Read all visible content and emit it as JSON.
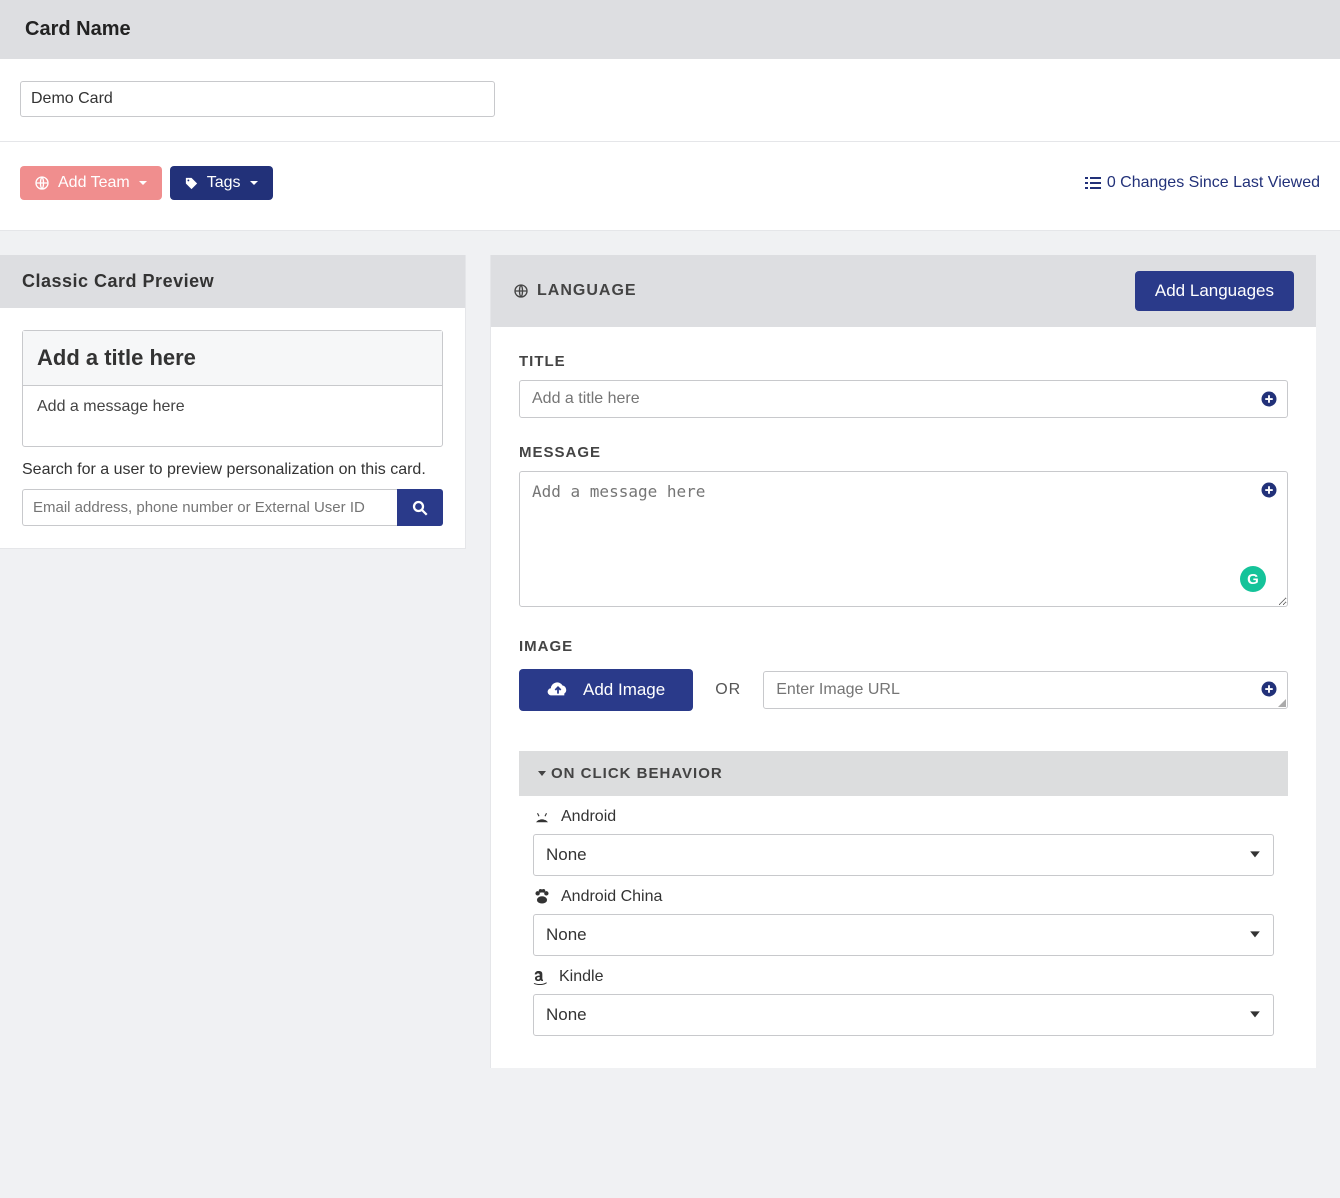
{
  "card_name": {
    "header": "Card Name",
    "value": "Demo Card"
  },
  "toolbar": {
    "add_team": "Add Team",
    "tags": "Tags",
    "changes_text": "0 Changes Since Last Viewed"
  },
  "preview": {
    "header": "Classic Card Preview",
    "title_placeholder": "Add a title here",
    "message_placeholder": "Add a message here",
    "search_hint": "Search for a user to preview personalization on this card.",
    "search_placeholder": "Email address, phone number or External User ID"
  },
  "language": {
    "header": "LANGUAGE",
    "add_button": "Add Languages"
  },
  "form": {
    "title_label": "TITLE",
    "title_placeholder": "Add a title here",
    "message_label": "MESSAGE",
    "message_placeholder": "Add a message here",
    "image_label": "IMAGE",
    "add_image_button": "Add Image",
    "or_label": "OR",
    "image_url_placeholder": "Enter Image URL"
  },
  "onclick": {
    "header": "ON CLICK BEHAVIOR",
    "platforms": [
      {
        "name": "Android",
        "value": "None"
      },
      {
        "name": "Android China",
        "value": "None"
      },
      {
        "name": "Kindle",
        "value": "None"
      }
    ]
  }
}
